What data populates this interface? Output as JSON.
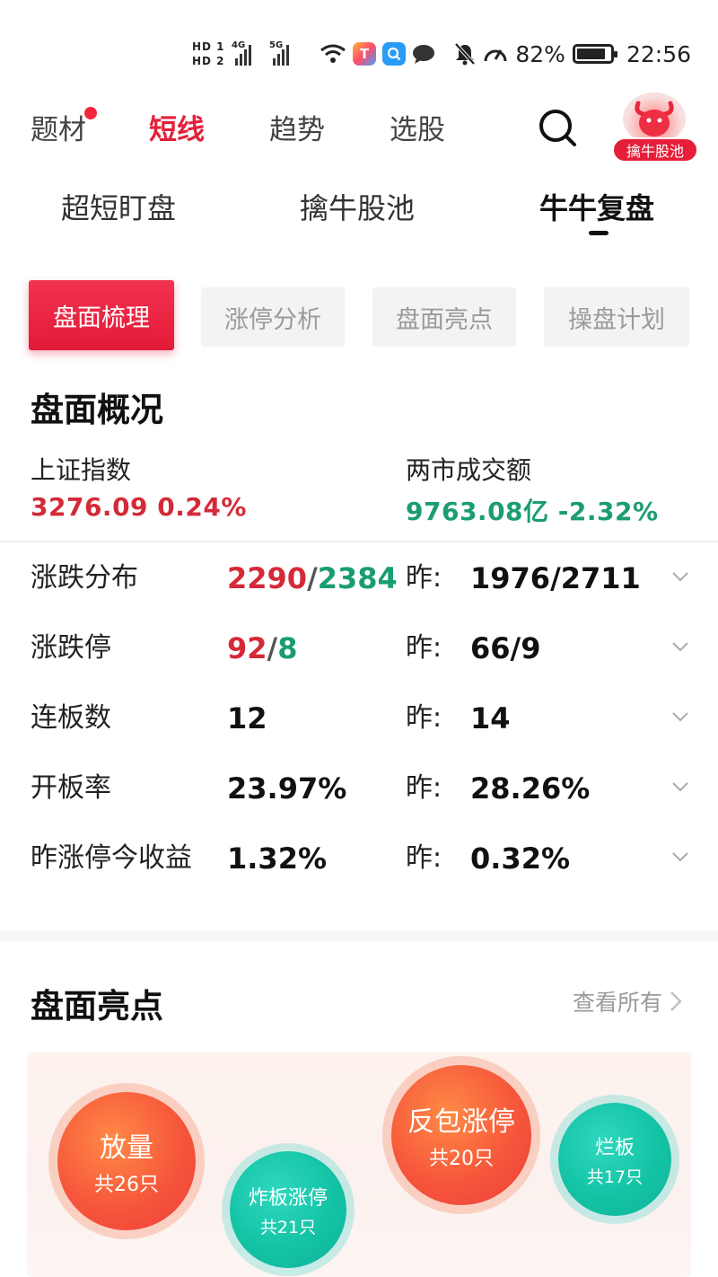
{
  "status_bar": {
    "hd1": "HD 1",
    "hd2": "HD 2",
    "net1": "4G",
    "net2": "5G",
    "battery_pct": "82%",
    "time": "22:56"
  },
  "top_nav": {
    "tabs": [
      {
        "label": "题材"
      },
      {
        "label": "短线"
      },
      {
        "label": "趋势"
      },
      {
        "label": "选股"
      }
    ],
    "active_tab": "短线",
    "badge_label": "擒牛股池"
  },
  "sub_nav": {
    "tabs": [
      {
        "label": "超短盯盘"
      },
      {
        "label": "擒牛股池"
      },
      {
        "label": "牛牛复盘"
      }
    ],
    "active_tab": "牛牛复盘"
  },
  "chips": [
    {
      "label": "盘面梳理"
    },
    {
      "label": "涨停分析"
    },
    {
      "label": "盘面亮点"
    },
    {
      "label": "操盘计划"
    }
  ],
  "overview": {
    "title": "盘面概况",
    "sh_index_label": "上证指数",
    "sh_index_value": "3276.09 0.24%",
    "turnover_label": "两市成交额",
    "turnover_value": "9763.08亿 -2.32%"
  },
  "stats": [
    {
      "label": "涨跌分布",
      "up": "2290",
      "sep": "/",
      "down": "2384",
      "prev_label": "昨:",
      "prev": "1976/2711"
    },
    {
      "label": "涨跌停",
      "up": "92",
      "sep": "/",
      "down": "8",
      "prev_label": "昨:",
      "prev": "66/9"
    },
    {
      "label": "连板数",
      "value": "12",
      "prev_label": "昨:",
      "prev": "14"
    },
    {
      "label": "开板率",
      "value": "23.97%",
      "prev_label": "昨:",
      "prev": "28.26%"
    },
    {
      "label": "昨涨停今收益",
      "value": "1.32%",
      "prev_label": "昨:",
      "prev": "0.32%"
    }
  ],
  "highlights": {
    "title": "盘面亮点",
    "view_all": "查看所有",
    "bubbles": [
      {
        "name": "放量",
        "count": "共26只",
        "color": "orange"
      },
      {
        "name": "炸板涨停",
        "count": "共21只",
        "color": "teal"
      },
      {
        "name": "反包涨停",
        "count": "共20只",
        "color": "orange"
      },
      {
        "name": "烂板",
        "count": "共17只",
        "color": "teal"
      }
    ]
  },
  "colors": {
    "accent_red": "#e3203a",
    "up_red": "#d42a38",
    "down_green": "#1a9d70"
  }
}
